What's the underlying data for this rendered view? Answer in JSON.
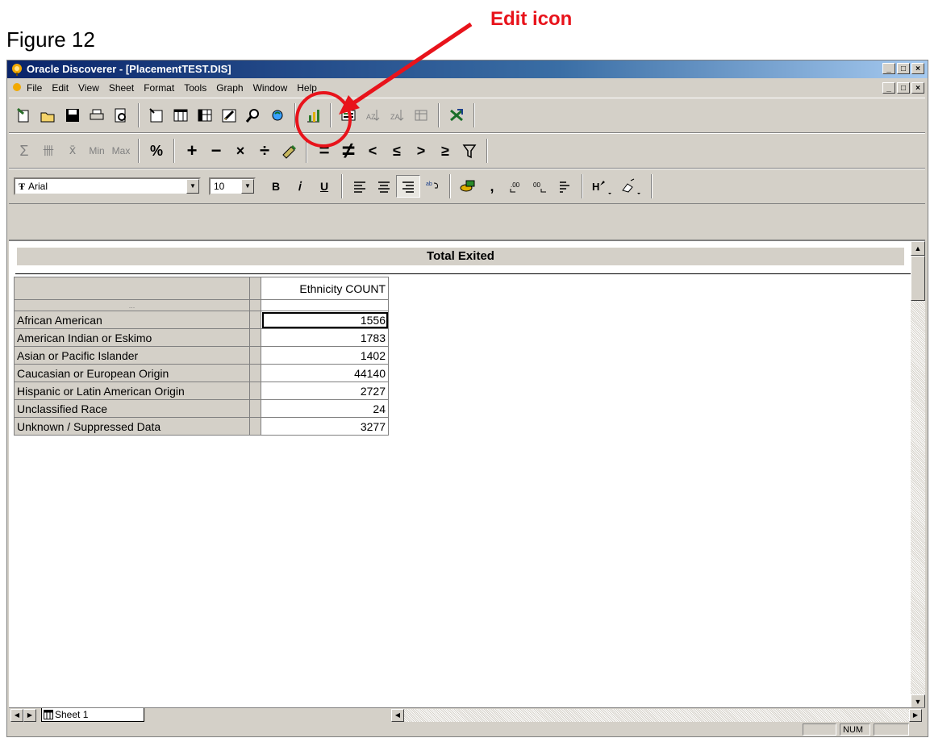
{
  "annotation": {
    "figure_label": "Figure 12",
    "callout_label": "Edit icon",
    "callout_color": "#e8131b"
  },
  "window": {
    "title": "Oracle Discoverer - [PlacementTEST.DIS]",
    "controls": [
      "_",
      "□",
      "×"
    ]
  },
  "menubar": {
    "items": [
      "File",
      "Edit",
      "View",
      "Sheet",
      "Format",
      "Tools",
      "Graph",
      "Window",
      "Help"
    ]
  },
  "toolbar1": {
    "icons": [
      "new-workbook-icon",
      "open-icon",
      "save-icon",
      "print-icon",
      "print-preview-icon",
      "new-sheet-wizard-icon",
      "table-layout-icon",
      "crosstab-layout-icon",
      "edit-sheet-icon",
      "find-icon",
      "drill-icon",
      "graph-icon",
      "totals-icon",
      "sort-ascending-icon",
      "sort-descending-icon",
      "pivot-icon",
      "export-excel-icon"
    ]
  },
  "toolbar2": {
    "agg_labels": [
      "Σ",
      "卌",
      "x̄",
      "Min",
      "Max"
    ],
    "percent_label": "%",
    "calc_labels": [
      "+",
      "−",
      "×",
      "÷"
    ],
    "cond_labels": [
      "=",
      "≠",
      "<",
      "≤",
      ">",
      "≥"
    ]
  },
  "toolbar3": {
    "font_name": "Arial",
    "font_size": "10",
    "style_labels": [
      "B",
      "𝑖",
      "U"
    ],
    "comma_label": ","
  },
  "sheet": {
    "title": "Total Exited",
    "column_header": "Ethnicity COUNT",
    "row_header_dots": "...",
    "rows": [
      {
        "label": "African American",
        "value": "1556"
      },
      {
        "label": "American Indian or Eskimo",
        "value": "1783"
      },
      {
        "label": "Asian or Pacific Islander",
        "value": "1402"
      },
      {
        "label": "Caucasian or European Origin",
        "value": "44140"
      },
      {
        "label": "Hispanic or Latin American Origin",
        "value": "2727"
      },
      {
        "label": "Unclassified Race",
        "value": "24"
      },
      {
        "label": "Unknown / Suppressed Data",
        "value": "3277"
      }
    ]
  },
  "tabs": {
    "sheet_name": "Sheet 1"
  },
  "status": {
    "num": "NUM"
  }
}
